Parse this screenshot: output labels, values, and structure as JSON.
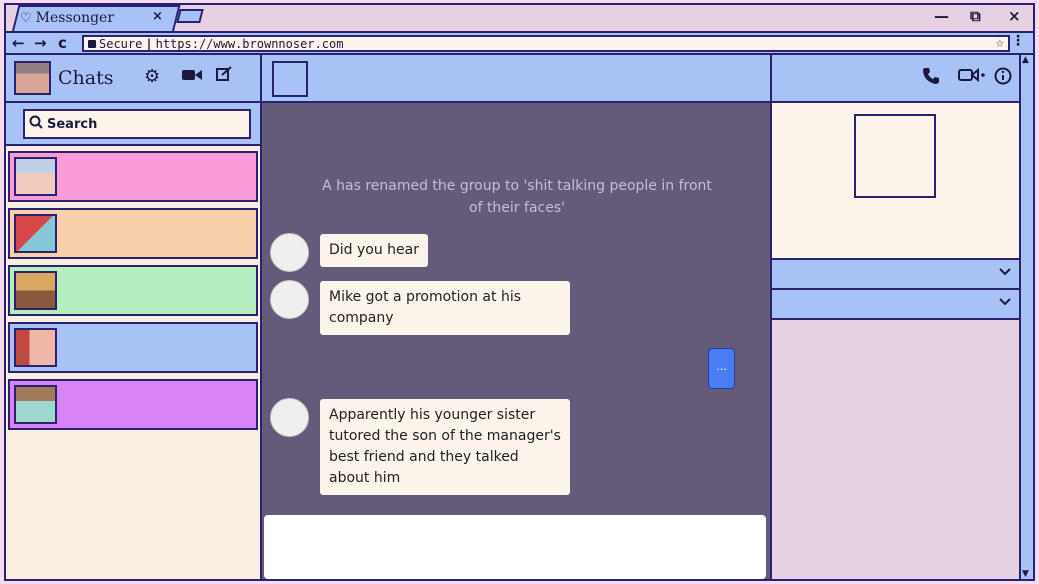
{
  "browser": {
    "tab_title": "Messonger",
    "tab_close": "×",
    "minimize": "—",
    "restore": "⧉",
    "close": "×",
    "nav_back": "←",
    "nav_forward": "→",
    "nav_reload": "c",
    "secure_label": "Secure",
    "url": "https://www.brownnoser.com",
    "star": "☆",
    "menu": "⋮"
  },
  "sidebar": {
    "title": "Chats",
    "search_placeholder": "Search",
    "chats": [
      {
        "color": "#f99bd6"
      },
      {
        "color": "#f8d1ac"
      },
      {
        "color": "#b6efbf"
      },
      {
        "color": "#a9c2f6"
      },
      {
        "color": "#d884f6"
      }
    ]
  },
  "conversation": {
    "system_message": "A has renamed the group to 'shit talking people in front of their faces'",
    "messages": [
      {
        "text": "Did you hear"
      },
      {
        "text": "Mike got a promotion at his company"
      },
      {
        "text": "Apparently his younger sister tutored the son of the manager's best friend and they talked about him"
      }
    ],
    "typing_indicator": "..."
  },
  "colors": {
    "accent_blue": "#a9c2f6",
    "outline": "#2a2270",
    "chat_bg": "#645a7a",
    "cream": "#fbf4eb",
    "typing_blue": "#4a7cf2"
  }
}
